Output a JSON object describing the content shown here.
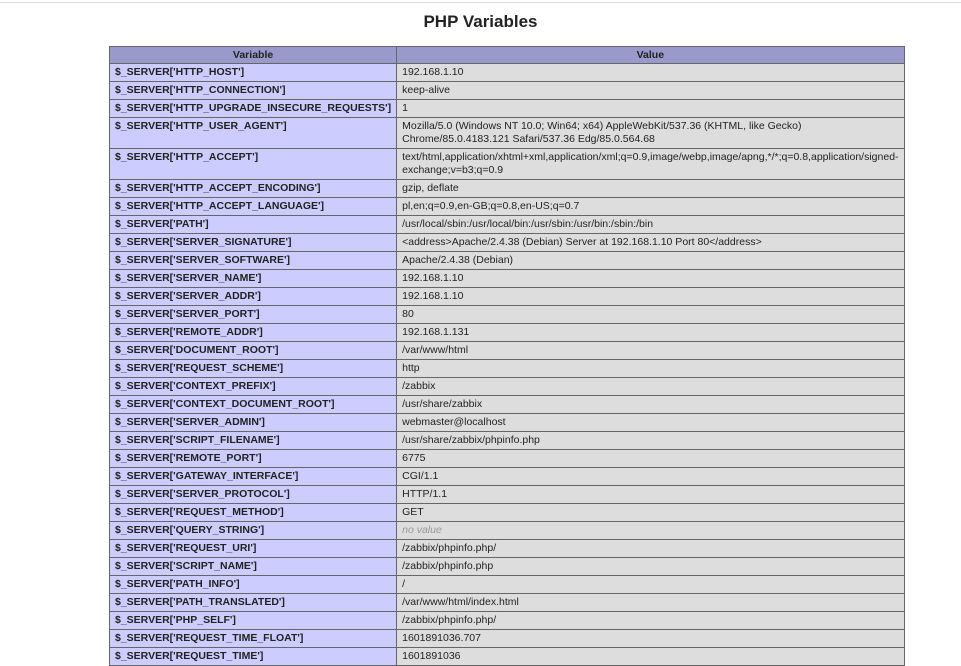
{
  "title": "PHP Variables",
  "headers": {
    "variable": "Variable",
    "value": "Value"
  },
  "rows": [
    {
      "name": "$_SERVER['HTTP_HOST']",
      "value": "192.168.1.10"
    },
    {
      "name": "$_SERVER['HTTP_CONNECTION']",
      "value": "keep-alive"
    },
    {
      "name": "$_SERVER['HTTP_UPGRADE_INSECURE_REQUESTS']",
      "value": "1"
    },
    {
      "name": "$_SERVER['HTTP_USER_AGENT']",
      "value": "Mozilla/5.0 (Windows NT 10.0; Win64; x64) AppleWebKit/537.36 (KHTML, like Gecko) Chrome/85.0.4183.121 Safari/537.36 Edg/85.0.564.68"
    },
    {
      "name": "$_SERVER['HTTP_ACCEPT']",
      "value": "text/html,application/xhtml+xml,application/xml;q=0.9,image/webp,image/apng,*/*;q=0.8,application/signed-exchange;v=b3;q=0.9"
    },
    {
      "name": "$_SERVER['HTTP_ACCEPT_ENCODING']",
      "value": "gzip, deflate"
    },
    {
      "name": "$_SERVER['HTTP_ACCEPT_LANGUAGE']",
      "value": "pl,en;q=0.9,en-GB;q=0.8,en-US;q=0.7"
    },
    {
      "name": "$_SERVER['PATH']",
      "value": "/usr/local/sbin:/usr/local/bin:/usr/sbin:/usr/bin:/sbin:/bin"
    },
    {
      "name": "$_SERVER['SERVER_SIGNATURE']",
      "value": "<address>Apache/2.4.38 (Debian) Server at 192.168.1.10 Port 80</address>"
    },
    {
      "name": "$_SERVER['SERVER_SOFTWARE']",
      "value": "Apache/2.4.38 (Debian)"
    },
    {
      "name": "$_SERVER['SERVER_NAME']",
      "value": "192.168.1.10"
    },
    {
      "name": "$_SERVER['SERVER_ADDR']",
      "value": "192.168.1.10"
    },
    {
      "name": "$_SERVER['SERVER_PORT']",
      "value": "80"
    },
    {
      "name": "$_SERVER['REMOTE_ADDR']",
      "value": "192.168.1.131"
    },
    {
      "name": "$_SERVER['DOCUMENT_ROOT']",
      "value": "/var/www/html"
    },
    {
      "name": "$_SERVER['REQUEST_SCHEME']",
      "value": "http"
    },
    {
      "name": "$_SERVER['CONTEXT_PREFIX']",
      "value": "/zabbix"
    },
    {
      "name": "$_SERVER['CONTEXT_DOCUMENT_ROOT']",
      "value": "/usr/share/zabbix"
    },
    {
      "name": "$_SERVER['SERVER_ADMIN']",
      "value": "webmaster@localhost"
    },
    {
      "name": "$_SERVER['SCRIPT_FILENAME']",
      "value": "/usr/share/zabbix/phpinfo.php"
    },
    {
      "name": "$_SERVER['REMOTE_PORT']",
      "value": "6775"
    },
    {
      "name": "$_SERVER['GATEWAY_INTERFACE']",
      "value": "CGI/1.1"
    },
    {
      "name": "$_SERVER['SERVER_PROTOCOL']",
      "value": "HTTP/1.1"
    },
    {
      "name": "$_SERVER['REQUEST_METHOD']",
      "value": "GET"
    },
    {
      "name": "$_SERVER['QUERY_STRING']",
      "value": "no value",
      "novalue": true
    },
    {
      "name": "$_SERVER['REQUEST_URI']",
      "value": "/zabbix/phpinfo.php/"
    },
    {
      "name": "$_SERVER['SCRIPT_NAME']",
      "value": "/zabbix/phpinfo.php"
    },
    {
      "name": "$_SERVER['PATH_INFO']",
      "value": "/"
    },
    {
      "name": "$_SERVER['PATH_TRANSLATED']",
      "value": "/var/www/html/index.html"
    },
    {
      "name": "$_SERVER['PHP_SELF']",
      "value": "/zabbix/phpinfo.php/"
    },
    {
      "name": "$_SERVER['REQUEST_TIME_FLOAT']",
      "value": "1601891036.707"
    },
    {
      "name": "$_SERVER['REQUEST_TIME']",
      "value": "1601891036"
    }
  ]
}
